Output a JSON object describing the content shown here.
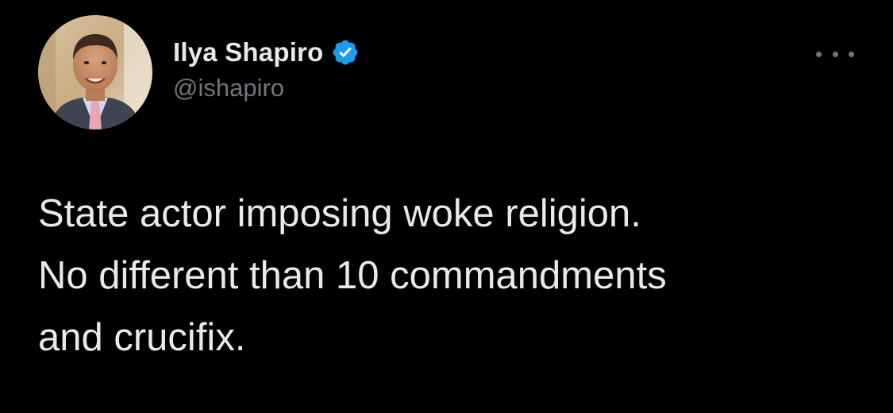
{
  "tweet": {
    "author": {
      "display_name": "Ilya Shapiro",
      "handle": "@ishapiro",
      "verified": true
    },
    "text_lines": [
      "State actor imposing woke religion.",
      "No different than 10 commandments",
      "and crucifix."
    ],
    "more_options_icon": "more-horizontal-icon",
    "verified_icon": "verified-badge-icon"
  },
  "colors": {
    "background": "#000000",
    "primary_text": "#e7e9ea",
    "secondary_text": "#71767b",
    "verified_blue": "#1d9bf0"
  }
}
